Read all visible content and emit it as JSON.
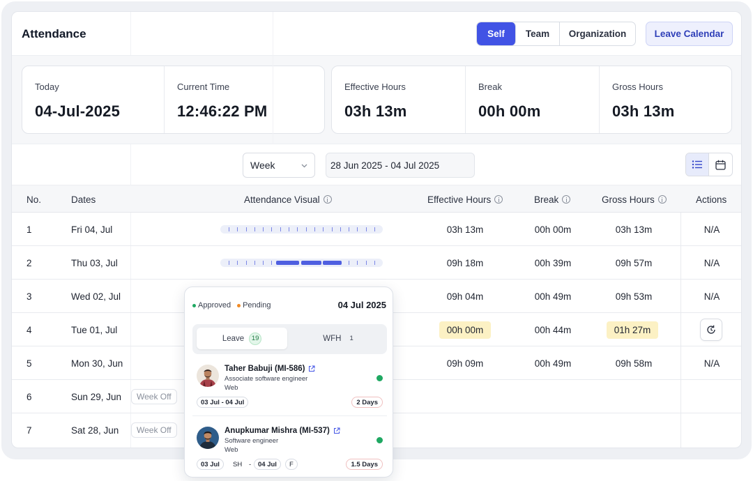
{
  "header": {
    "title": "Attendance",
    "scope_tabs": [
      {
        "label": "Self",
        "active": true
      },
      {
        "label": "Team",
        "active": false
      },
      {
        "label": "Organization",
        "active": false
      }
    ],
    "leave_calendar_label": "Leave Calendar"
  },
  "stats_left": [
    {
      "label": "Today",
      "value": "04-Jul-2025"
    },
    {
      "label": "Current Time",
      "value": "12:46:22 PM"
    }
  ],
  "stats_right": [
    {
      "label": "Effective Hours",
      "value": "03h 13m"
    },
    {
      "label": "Break",
      "value": "00h 00m"
    },
    {
      "label": "Gross Hours",
      "value": "03h 13m"
    }
  ],
  "filters": {
    "period": "Week",
    "date_range": "28 Jun 2025 - 04 Jul 2025",
    "view_modes": [
      {
        "icon": "list-icon",
        "active": true
      },
      {
        "icon": "calendar-icon",
        "active": false
      }
    ]
  },
  "table": {
    "columns": {
      "no": "No.",
      "dates": "Dates",
      "visual": "Attendance Visual",
      "effective": "Effective Hours",
      "break": "Break",
      "gross": "Gross Hours",
      "actions": "Actions"
    },
    "rows": [
      {
        "no": "1",
        "date": "Fri 04, Jul",
        "effective": "03h 13m",
        "break": "00h 00m",
        "gross": "03h 13m",
        "action": "N/A"
      },
      {
        "no": "2",
        "date": "Thu 03, Jul",
        "effective": "09h 18m",
        "break": "00h 39m",
        "gross": "09h 57m",
        "action": "N/A"
      },
      {
        "no": "3",
        "date": "Wed 02, Jul",
        "effective": "09h 04m",
        "break": "00h 49m",
        "gross": "09h 53m",
        "action": "N/A"
      },
      {
        "no": "4",
        "date": "Tue 01, Jul",
        "effective": "00h 00m",
        "break": "00h 44m",
        "gross": "01h 27m",
        "action": "regularize-icon"
      },
      {
        "no": "5",
        "date": "Mon 30, Jun",
        "effective": "09h 09m",
        "break": "00h 49m",
        "gross": "09h 58m",
        "action": "N/A"
      },
      {
        "no": "6",
        "date": "Sun 29, Jun",
        "tag": "Week Off"
      },
      {
        "no": "7",
        "date": "Sat 28, Jun",
        "tag": "Week Off"
      }
    ]
  },
  "popover": {
    "legend": [
      {
        "label": "Approved",
        "color": "#1fa862"
      },
      {
        "label": "Pending",
        "color": "#f08a24"
      }
    ],
    "date": "04 Jul 2025",
    "tabs": [
      {
        "label": "Leave",
        "count": "19",
        "active": true
      },
      {
        "label": "WFH",
        "count": "1",
        "active": false
      }
    ],
    "people": [
      {
        "name": "Taher Babuji (MI-586)",
        "role": "Associate software engineer",
        "dept": "Web",
        "range": "03 Jul - 04 Jul",
        "days": "2 Days"
      },
      {
        "name": "Anupkumar Mishra (MI-537)",
        "role": "Software engineer",
        "dept": "Web",
        "from": "03 Jul",
        "from_half": "SH",
        "dash": "-",
        "to": "04 Jul",
        "to_half": "F",
        "days": "1.5 Days"
      }
    ]
  },
  "colors": {
    "accent": "#4153e5",
    "highlight_yellow": "#fcf1c4",
    "approved": "#1fa862",
    "pending": "#f08a24"
  }
}
